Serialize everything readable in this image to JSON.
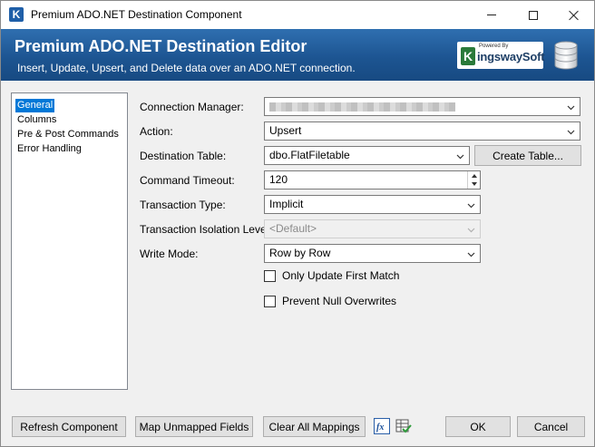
{
  "window": {
    "title": "Premium ADO.NET Destination Component",
    "app_icon_letter": "K"
  },
  "banner": {
    "title": "Premium ADO.NET Destination Editor",
    "subtitle": "Insert, Update, Upsert, and Delete data over an ADO.NET connection.",
    "brand_powered": "Powered By",
    "brand_k": "K",
    "brand_name": "ingswaySoft"
  },
  "nav": {
    "items": [
      {
        "label": "General",
        "selected": true
      },
      {
        "label": "Columns",
        "selected": false
      },
      {
        "label": "Pre & Post Commands",
        "selected": false
      },
      {
        "label": "Error Handling",
        "selected": false
      }
    ]
  },
  "form": {
    "connection_manager": {
      "label": "Connection Manager:",
      "value": ""
    },
    "action": {
      "label": "Action:",
      "value": "Upsert"
    },
    "destination_table": {
      "label": "Destination Table:",
      "value": "dbo.FlatFiletable",
      "create_button": "Create Table..."
    },
    "command_timeout": {
      "label": "Command Timeout:",
      "value": "120"
    },
    "transaction_type": {
      "label": "Transaction Type:",
      "value": "Implicit"
    },
    "isolation_level": {
      "label": "Transaction Isolation Level:",
      "value": "<Default>"
    },
    "write_mode": {
      "label": "Write Mode:",
      "value": "Row by Row"
    },
    "only_update_first_match": {
      "label": "Only Update First Match",
      "checked": false
    },
    "prevent_null_overwrites": {
      "label": "Prevent Null Overwrites",
      "checked": false
    }
  },
  "footer": {
    "refresh": "Refresh Component",
    "map_unmapped": "Map Unmapped Fields",
    "clear_mappings": "Clear All Mappings",
    "ok": "OK",
    "cancel": "Cancel"
  },
  "colors": {
    "banner": "#1d5592",
    "selection": "#0078d7",
    "button_face": "#e1e1e1"
  }
}
